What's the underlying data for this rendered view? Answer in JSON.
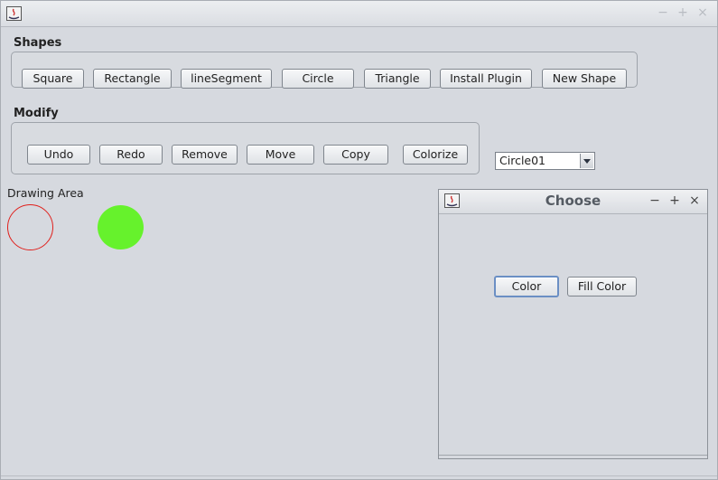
{
  "window": {
    "title": "",
    "controls": [
      "minimize-icon",
      "maximize-icon",
      "close-icon"
    ]
  },
  "shapes": {
    "label": "Shapes",
    "buttons": [
      "Square",
      "Rectangle",
      "lineSegment",
      "Circle",
      "Triangle",
      "Install Plugin",
      "New Shape"
    ]
  },
  "modify": {
    "label": "Modify",
    "buttons": [
      "Undo",
      "Redo",
      "Remove",
      "Move",
      "Copy",
      "Colorize"
    ]
  },
  "shape_selector": {
    "selected": "Circle01"
  },
  "drawing_area": {
    "label": "Drawing Area",
    "shapes": [
      {
        "type": "circle",
        "outline": "#e0201c",
        "fill": "none"
      },
      {
        "type": "circle",
        "outline": "#66f22c",
        "fill": "#66f22c"
      }
    ]
  },
  "choose_dialog": {
    "title": "Choose",
    "color_button": "Color",
    "fill_color_button": "Fill Color"
  },
  "colors": {
    "background": "#d6d9df",
    "focus_ring": "#6b8fc4"
  }
}
